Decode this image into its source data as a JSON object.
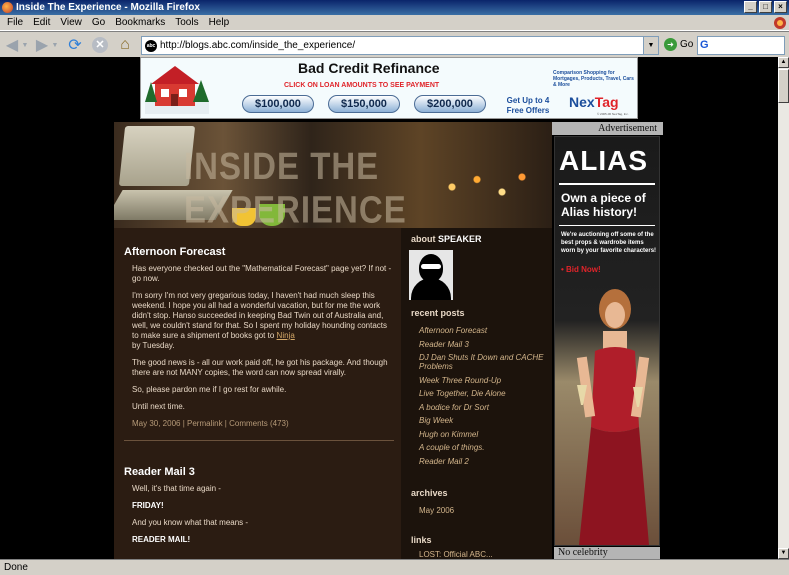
{
  "window": {
    "title": "Inside The Experience - Mozilla Firefox",
    "controls": [
      "_",
      "□",
      "×"
    ]
  },
  "menu": [
    "File",
    "Edit",
    "View",
    "Go",
    "Bookmarks",
    "Tools",
    "Help"
  ],
  "nav": {
    "url": "http://blogs.abc.com/inside_the_experience/",
    "site_badge": "abc",
    "go_label": "Go",
    "search_value": ""
  },
  "banner": {
    "headline": "Bad Credit Refinance",
    "subhead": "CLICK ON LOAN AMOUNTS TO SEE PAYMENT",
    "amounts": [
      "$100,000",
      "$150,000",
      "$200,000"
    ],
    "offers": "Get Up to 4 Free Offers",
    "compare": "Comparison Shopping for Mortgages, Products, Travel, Cars & More",
    "brand_a": "Nex",
    "brand_b": "Tag",
    "copyright": "© 2005-06 NexTag, Inc."
  },
  "header": {
    "title": "INSIDE THE EXPERIENCE"
  },
  "ad": {
    "label": "Advertisement",
    "logo": "ALIAS",
    "headline": "Own a piece of Alias history!",
    "body": "We're auctioning off some of the best props & wardrobe items worn by your favorite characters!",
    "cta": "• Bid Now!",
    "footer": "No celebrity"
  },
  "posts": [
    {
      "title": "Afternoon Forecast",
      "paragraphs": [
        "Has everyone checked out the \"Mathematical Forecast\" page yet? If not - go now.",
        "I'm sorry I'm not very gregarious today, I haven't had much sleep this weekend. I hope you all had a wonderful vacation, but for me the work didn't stop. Hanso succeeded in keeping Bad Twin out of Australia and, well, we couldn't stand for that. So I spent my holiday hounding contacts to make sure a shipment of books got to",
        "by Tuesday.",
        "The good news is - all our work paid off, he got his package. And though there are not MANY copies, the word can now spread virally.",
        "So, please pardon me if I go rest for awhile.",
        "Until next time."
      ],
      "link": "Ninja",
      "meta": "May 30, 2006 | Permalink | Comments (473)"
    },
    {
      "title": "Reader Mail 3",
      "paragraphs": [
        "Well, it's that time again -",
        "FRIDAY!",
        "And you know what that means -",
        "READER MAIL!"
      ]
    }
  ],
  "sidebar": {
    "about_a": "about",
    "about_b": "SPEAKER",
    "recent_heading": "recent posts",
    "recent": [
      "Afternoon Forecast",
      "Reader Mail 3",
      "DJ Dan Shuts It Down and CACHE Problems",
      "Week Three Round-Up",
      "Live Together, Die Alone",
      "A bodice for Dr Sort",
      "Big Week",
      "Hugh on Kimmel",
      "A couple of things.",
      "Reader Mail 2"
    ],
    "archives_heading": "archives",
    "archives": [
      "May 2006"
    ],
    "links_heading": "links",
    "links_partial": "LOST: Official ABC..."
  },
  "status": "Done"
}
